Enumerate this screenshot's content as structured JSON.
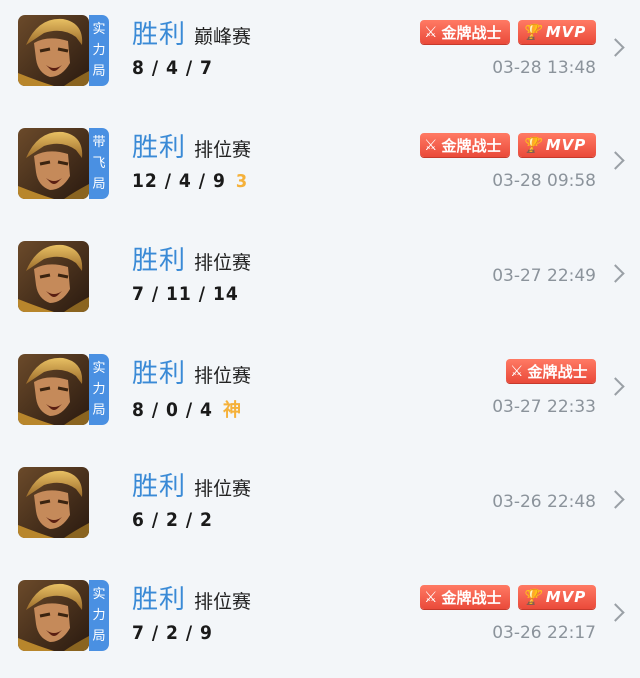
{
  "icons": {
    "avatar": "hero-avatar",
    "gold_badge_icon": "sword-icon",
    "mvp_badge_icon": "trophy-icon",
    "chevron": "chevron-right-icon"
  },
  "colors": {
    "result": "#3a8ad6",
    "tag": "#4a90e2",
    "badge": "#ea4a3a",
    "mark": "#f5b13a"
  },
  "matches": [
    {
      "tag": [
        "实",
        "力",
        "局"
      ],
      "result": "胜利",
      "mode": "巅峰赛",
      "kda": "8 / 4 / 7",
      "mark": "",
      "badges": [
        {
          "type": "gold",
          "label": "金牌战士"
        },
        {
          "type": "mvp",
          "label": "MVP"
        }
      ],
      "time": "03-28 13:48"
    },
    {
      "tag": [
        "带",
        "飞",
        "局"
      ],
      "result": "胜利",
      "mode": "排位赛",
      "kda": "12 / 4 / 9",
      "mark": "3",
      "badges": [
        {
          "type": "gold",
          "label": "金牌战士"
        },
        {
          "type": "mvp",
          "label": "MVP"
        }
      ],
      "time": "03-28 09:58"
    },
    {
      "tag": [],
      "result": "胜利",
      "mode": "排位赛",
      "kda": "7 / 11 / 14",
      "mark": "",
      "badges": [],
      "time": "03-27 22:49"
    },
    {
      "tag": [
        "实",
        "力",
        "局"
      ],
      "result": "胜利",
      "mode": "排位赛",
      "kda": "8 / 0 / 4",
      "mark": "神",
      "badges": [
        {
          "type": "gold",
          "label": "金牌战士"
        }
      ],
      "time": "03-27 22:33"
    },
    {
      "tag": [],
      "result": "胜利",
      "mode": "排位赛",
      "kda": "6 / 2 / 2",
      "mark": "",
      "badges": [],
      "time": "03-26 22:48"
    },
    {
      "tag": [
        "实",
        "力",
        "局"
      ],
      "result": "胜利",
      "mode": "排位赛",
      "kda": "7 / 2 / 9",
      "mark": "",
      "badges": [
        {
          "type": "gold",
          "label": "金牌战士"
        },
        {
          "type": "mvp",
          "label": "MVP"
        }
      ],
      "time": "03-26 22:17"
    }
  ]
}
